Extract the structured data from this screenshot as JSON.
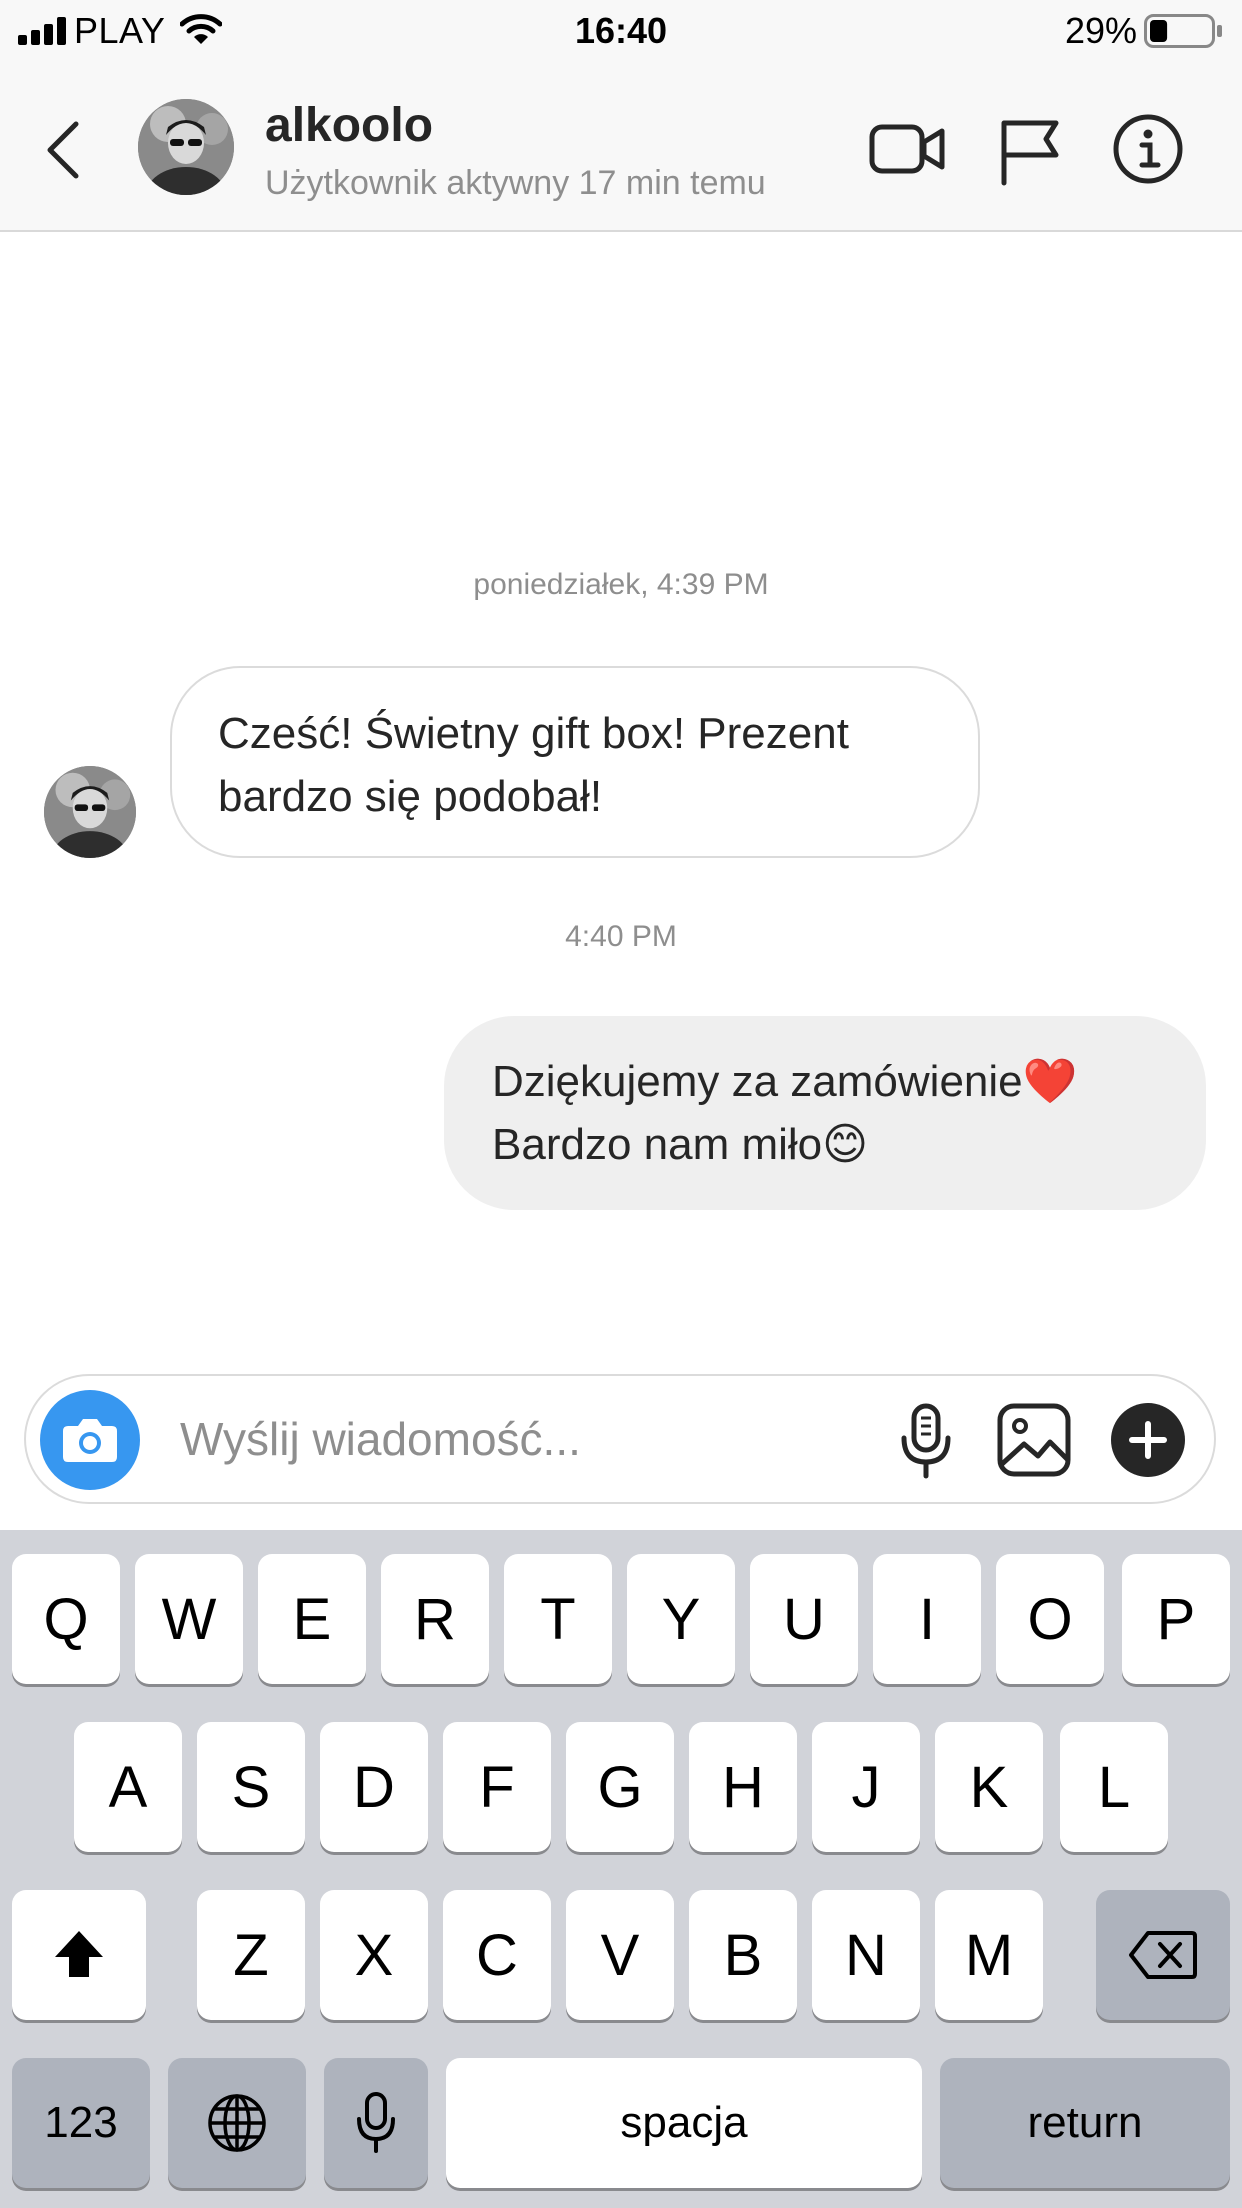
{
  "status_bar": {
    "carrier": "PLAY",
    "time": "16:40",
    "battery": "29%",
    "battery_level": 0.29
  },
  "header": {
    "username": "alkoolo",
    "presence": "Użytkownik aktywny 17 min temu",
    "icons": [
      "chevron-left-icon",
      "avatar",
      "video-camera-icon",
      "flag-icon",
      "info-icon"
    ]
  },
  "thread": {
    "timestamp_1": "poniedziałek, 4:39 PM",
    "incoming": {
      "line1": "Cześć! Świetny gift box! Prezent",
      "line2": "bardzo się podobał!"
    },
    "timestamp_2": "4:40 PM",
    "outgoing": {
      "line1": "Dziękujemy za zamówienie❤️",
      "line2": "Bardzo nam miło😊"
    }
  },
  "composer": {
    "placeholder": "Wyślij wiadomość...",
    "value": "",
    "icons": [
      "camera-icon",
      "microphone-icon",
      "gallery-icon",
      "plus-icon"
    ],
    "camera_color": "#3797f0"
  },
  "keyboard": {
    "row1": [
      "Q",
      "W",
      "E",
      "R",
      "T",
      "Y",
      "U",
      "I",
      "O",
      "P"
    ],
    "row2": [
      "A",
      "S",
      "D",
      "F",
      "G",
      "H",
      "J",
      "K",
      "L"
    ],
    "row3": [
      "Z",
      "X",
      "C",
      "V",
      "B",
      "N",
      "M"
    ],
    "numbers_label": "123",
    "space_label": "spacja",
    "return_label": "return",
    "icons": [
      "shift-icon",
      "backspace-icon",
      "globe-icon",
      "dictation-mic-icon"
    ]
  }
}
